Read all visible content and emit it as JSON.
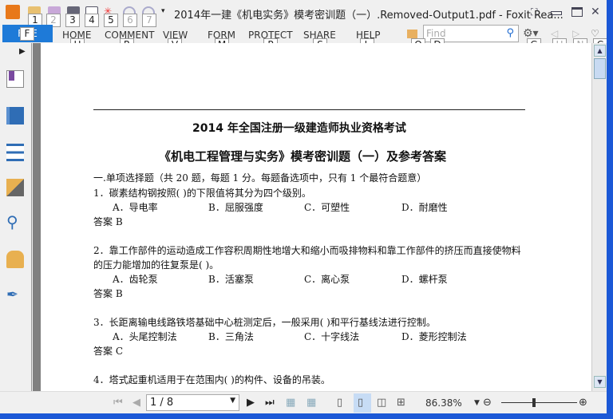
{
  "window": {
    "title": "2014年一建《机电实务》模考密训题（一）.Removed-Output1.pdf - Foxit Rea..."
  },
  "quick_access": {
    "keytips": [
      "1",
      "2",
      "3",
      "4",
      "5",
      "6",
      "7"
    ]
  },
  "ribbon": {
    "file_tab": {
      "label": "FILE",
      "keytip": "F"
    },
    "tabs": [
      {
        "label": "HOME",
        "keytip": "H"
      },
      {
        "label": "COMMENT",
        "keytip": "R"
      },
      {
        "label": "VIEW",
        "keytip": "V"
      },
      {
        "label": "FORM",
        "keytip": "M"
      },
      {
        "label": "PROTECT",
        "keytip": "P"
      },
      {
        "label": "SHARE",
        "keytip": "S"
      },
      {
        "label": "HELP",
        "keytip": "L"
      }
    ],
    "find": {
      "placeholder": "Find",
      "keytip_folder": "Q",
      "keytip_find": "D"
    },
    "keytips_right": [
      "G",
      "U",
      "N",
      "C"
    ]
  },
  "sidebar": {
    "items": [
      "bookmark-icon",
      "pages-icon",
      "layers-icon",
      "comments-icon",
      "attachments-icon",
      "security-icon",
      "signature-icon"
    ]
  },
  "document": {
    "title1": "2014 年全国注册一级建造师执业资格考试",
    "title2": "《机电工程管理与实务》模考密训题（一）及参考答案",
    "section": "一.单项选择题（共 20 题，每题 1 分。每题备选项中，只有 1 个最符合题意）",
    "questions": [
      {
        "q": "1．碳素结构钢按照(    )的下限值将其分为四个级别。",
        "opts": [
          "A．导电率",
          "B．屈服强度",
          "C．可塑性",
          "D．耐磨性"
        ],
        "answer": "答案  B"
      },
      {
        "q": "2．靠工作部件的运动造成工作容积周期性地增大和缩小而吸排物料和靠工作部件的挤压而直接使物料",
        "q2": "的压力能增加的往复泵是( )。",
        "opts": [
          "A．齿轮泵",
          "B．活塞泵",
          "C．离心泵",
          "D．螺杆泵"
        ],
        "answer": "答案  B"
      },
      {
        "q": "3．长距离输电线路铁塔基础中心桩测定后，一般采用(    )和平行基线法进行控制。",
        "opts": [
          "A．头尾控制法",
          "B．三角法",
          "C．十字线法",
          "D．菱形控制法"
        ],
        "answer": "答案  C"
      },
      {
        "q": "4．塔式起重机适用于在范围内(    )的构件、设备的吊装。"
      }
    ]
  },
  "status": {
    "page": "1 / 8",
    "zoom": "86.38%",
    "zoom_level_percent": 86.38
  },
  "colors": {
    "file_tab": "#1e7ad8",
    "window_border": "#1b58d6"
  }
}
